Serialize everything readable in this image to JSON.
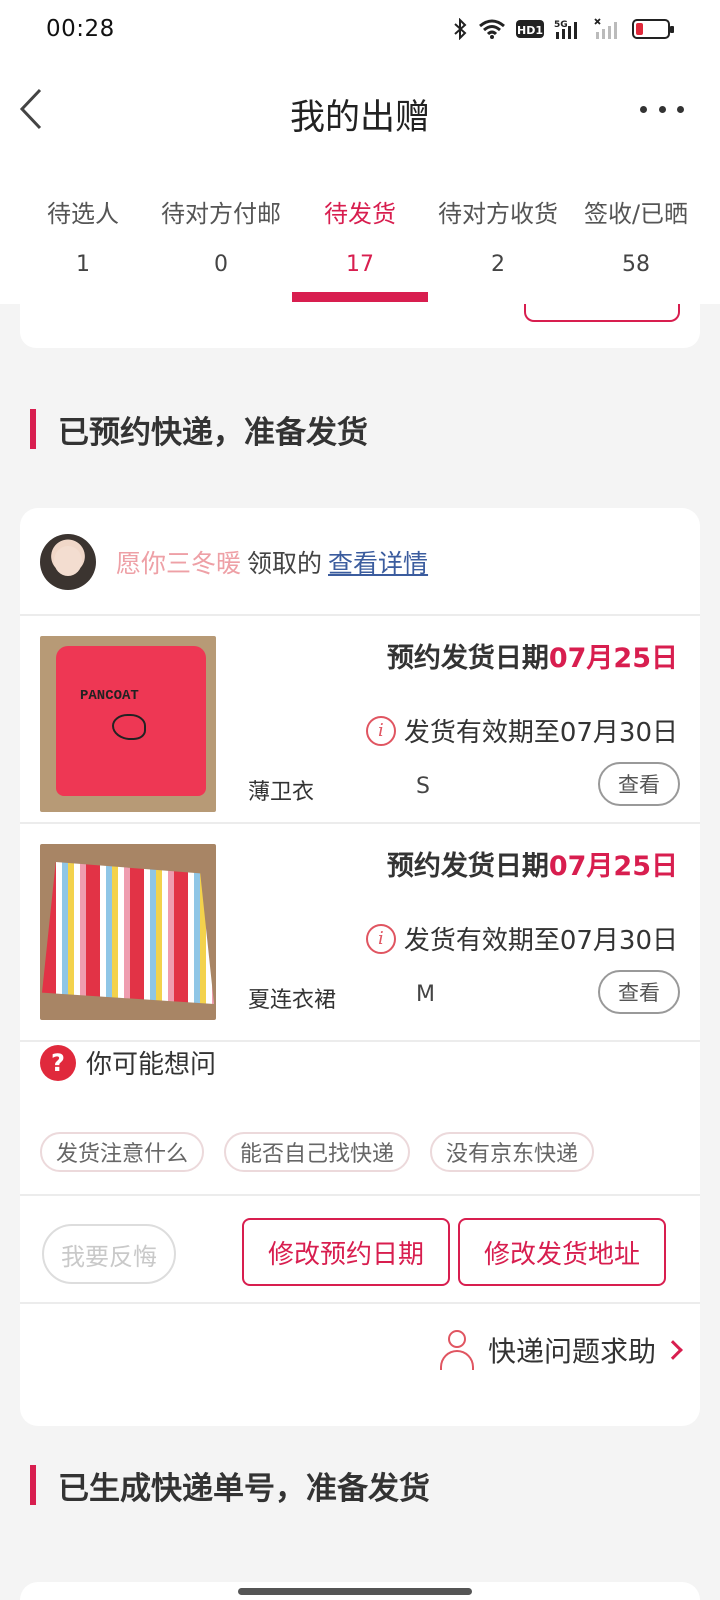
{
  "status_bar": {
    "time": "00:28",
    "icons": [
      "bluetooth-icon",
      "wifi-icon",
      "hd-icon",
      "5g-signal-icon",
      "signal-icon",
      "battery-icon"
    ],
    "hd_label": "HD1",
    "net_label": "5G"
  },
  "header": {
    "title": "我的出赠"
  },
  "tabs": [
    {
      "label": "待选人",
      "count": "1"
    },
    {
      "label": "待对方付邮",
      "count": "0"
    },
    {
      "label": "待发货",
      "count": "17"
    },
    {
      "label": "待对方收货",
      "count": "2"
    },
    {
      "label": "签收/已晒",
      "count": "58"
    }
  ],
  "active_tab": 2,
  "sections": {
    "reserved": "已预约快递，准备发货",
    "generated": "已生成快递单号，准备发货"
  },
  "card": {
    "receiver_name": "愿你三冬暖",
    "receiver_verb": "领取的",
    "details_link": "查看详情",
    "items": [
      {
        "ship_label": "预约发货日期",
        "ship_date": "07月25日",
        "validity": "发货有效期至07月30日",
        "name": "薄卫衣",
        "size": "S",
        "view": "查看",
        "thumb_text": "PANCOAT"
      },
      {
        "ship_label": "预约发货日期",
        "ship_date": "07月25日",
        "validity": "发货有效期至07月30日",
        "name": "夏连衣裙",
        "size": "M",
        "view": "查看"
      }
    ],
    "faq_title": "你可能想问",
    "chips": [
      "发货注意什么",
      "能否自己找快递",
      "没有京东快递"
    ],
    "regret_label": "我要反悔",
    "change_date_label": "修改预约日期",
    "change_address_label": "修改发货地址",
    "help_label": "快递问题求助"
  },
  "colors": {
    "accent": "#d81e4f",
    "link": "#3b5c9e",
    "receiver_name": "#eea0a6"
  }
}
